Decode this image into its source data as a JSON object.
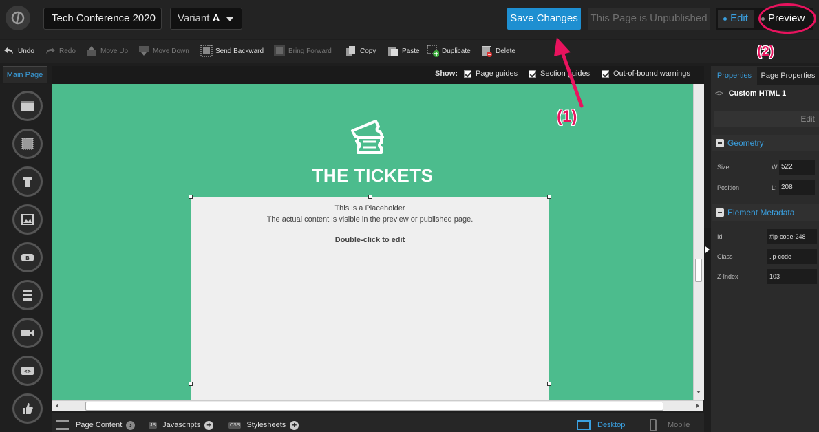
{
  "header": {
    "page_name": "Tech Conference 2020",
    "variant_label": "Variant",
    "variant_value": "A",
    "save_button": "Save Changes",
    "publish_status": "This Page is Unpublished",
    "edit_label": "Edit",
    "preview_label": "Preview"
  },
  "toolbar": {
    "undo": "Undo",
    "redo": "Redo",
    "move_up": "Move Up",
    "move_down": "Move Down",
    "send_backward": "Send Backward",
    "bring_forward": "Bring Forward",
    "copy": "Copy",
    "paste": "Paste",
    "duplicate": "Duplicate",
    "delete": "Delete"
  },
  "tabs": {
    "main_page": "Main Page"
  },
  "show_bar": {
    "label": "Show:",
    "page_guides": "Page guides",
    "section_guides": "Section guides",
    "out_of_bound": "Out-of-bound warnings"
  },
  "canvas": {
    "heading": "THE TICKETS",
    "placeholder_line1": "This is a Placeholder",
    "placeholder_line2": "The actual content is visible in the preview or published page.",
    "placeholder_action": "Double-click to edit",
    "background_color": "#4cbc8d"
  },
  "bottom": {
    "page_content": "Page Content",
    "javascripts": "Javascripts",
    "js_tag": "JS",
    "stylesheets": "Stylesheets",
    "css_tag": "CSS",
    "desktop": "Desktop",
    "mobile": "Mobile"
  },
  "right_panel": {
    "tab_properties": "Properties",
    "tab_page_properties": "Page Properties",
    "element_name": "Custom HTML 1",
    "edit_button": "Edit",
    "geometry_title": "Geometry",
    "size_label": "Size",
    "size_w_label": "W:",
    "size_w_value": "522",
    "position_label": "Position",
    "position_l_label": "L:",
    "position_l_value": "208",
    "metadata_title": "Element Metadata",
    "id_label": "Id",
    "id_value": "#lp-code-248",
    "class_label": "Class",
    "class_value": ".lp-code",
    "zindex_label": "Z-Index",
    "zindex_value": "103"
  },
  "annotations": {
    "one": "(1)",
    "two": "(2)"
  },
  "colors": {
    "accent": "#1e8fd1",
    "annotation": "#e8135e"
  }
}
